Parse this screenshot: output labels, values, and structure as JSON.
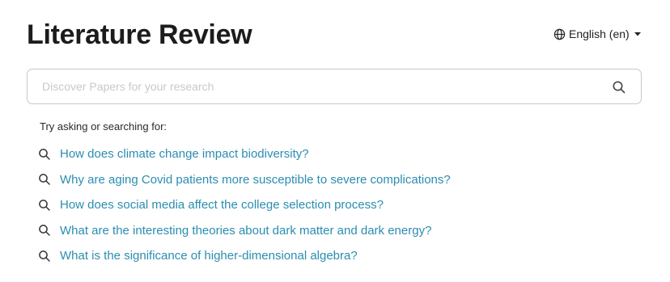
{
  "header": {
    "title": "Literature Review",
    "language": {
      "label": "English (en)",
      "icon": "globe-icon",
      "caret_icon": "caret-down-icon"
    }
  },
  "search": {
    "placeholder": "Discover Papers for your research",
    "value": "",
    "icon": "search-icon"
  },
  "suggestions": {
    "label": "Try asking or searching for:",
    "items": [
      {
        "text": "How does climate change impact biodiversity?",
        "icon": "search-icon"
      },
      {
        "text": "Why are aging Covid patients more susceptible to severe complications?",
        "icon": "search-icon"
      },
      {
        "text": "How does social media affect the college selection process?",
        "icon": "search-icon"
      },
      {
        "text": "What are the interesting theories about dark matter and dark energy?",
        "icon": "search-icon"
      },
      {
        "text": "What is the significance of higher-dimensional algebra?",
        "icon": "search-icon"
      }
    ]
  },
  "colors": {
    "link": "#2b8db0",
    "title": "#1c1c1c",
    "border": "#c8c8c8",
    "placeholder": "#c9c9c9"
  }
}
